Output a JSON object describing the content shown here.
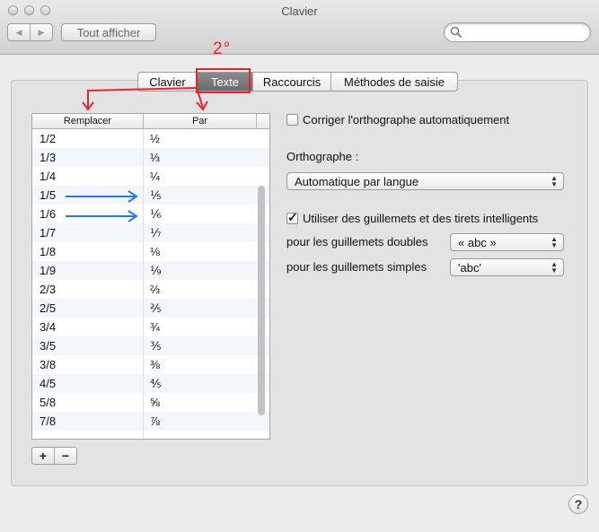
{
  "window": {
    "title": "Clavier"
  },
  "toolbar": {
    "back_glyph": "◀",
    "forward_glyph": "▶",
    "show_all_label": "Tout afficher",
    "search_value": ""
  },
  "tabs": [
    {
      "label": "Clavier",
      "active": false
    },
    {
      "label": "Texte",
      "active": true
    },
    {
      "label": "Raccourcis",
      "active": false
    },
    {
      "label": "Méthodes de saisie",
      "active": false
    }
  ],
  "annotation": {
    "label": "2°",
    "color": "#e5262b",
    "arrow_color": "#1f7ee0"
  },
  "table": {
    "columns": [
      "Remplacer",
      "Par"
    ],
    "rows": [
      {
        "replace": "1/2",
        "with": "½"
      },
      {
        "replace": "1/3",
        "with": "⅓"
      },
      {
        "replace": "1/4",
        "with": "¼"
      },
      {
        "replace": "1/5",
        "with": "⅕"
      },
      {
        "replace": "1/6",
        "with": "⅙"
      },
      {
        "replace": "1/7",
        "with": "⅐"
      },
      {
        "replace": "1/8",
        "with": "⅛"
      },
      {
        "replace": "1/9",
        "with": "⅑"
      },
      {
        "replace": "2/3",
        "with": "⅔"
      },
      {
        "replace": "2/5",
        "with": "⅖"
      },
      {
        "replace": "3/4",
        "with": "¾"
      },
      {
        "replace": "3/5",
        "with": "⅗"
      },
      {
        "replace": "3/8",
        "with": "⅜"
      },
      {
        "replace": "4/5",
        "with": "⅘"
      },
      {
        "replace": "5/8",
        "with": "⅝"
      },
      {
        "replace": "7/8",
        "with": "⅞"
      },
      {
        "replace": "",
        "with": ""
      }
    ],
    "add_label": "+",
    "remove_label": "−"
  },
  "settings": {
    "autocorrect": {
      "label": "Corriger l'orthographe automatiquement",
      "checked": false
    },
    "spelling_label": "Orthographe :",
    "spelling_value": "Automatique par langue",
    "smart_quotes": {
      "label": "Utiliser des guillemets et des tirets intelligents",
      "checked": true
    },
    "double_quotes_label": "pour les guillemets doubles",
    "double_quotes_value": "« abc »",
    "single_quotes_label": "pour les guillemets simples",
    "single_quotes_value": "'abc'"
  },
  "help_label": "?"
}
